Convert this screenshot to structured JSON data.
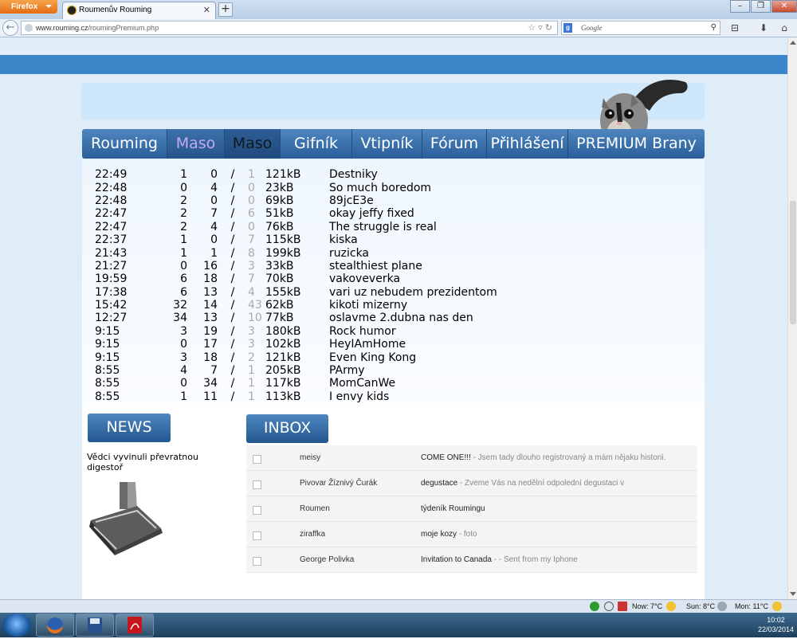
{
  "browser": {
    "menu_button": "Firefox",
    "tab_title": "Roumenův Rouming",
    "url_domain": "www.rouming.cz",
    "url_path": "/roumingPremium.php",
    "search_engine": "Google",
    "search_placeholder": "Google"
  },
  "menu": [
    "Rouming",
    "Maso",
    "Maso",
    "Gifník",
    "Vtipník",
    "Fórum",
    "Přihlášení",
    "PREMIUM Brany"
  ],
  "rows": [
    {
      "time": "22:49",
      "a": "1",
      "b": "0",
      "c": "1",
      "size": "121kB",
      "title": "Destniky"
    },
    {
      "time": "22:48",
      "a": "0",
      "b": "4",
      "c": "0",
      "size": "23kB",
      "title": "So much boredom"
    },
    {
      "time": "22:48",
      "a": "2",
      "b": "0",
      "c": "0",
      "size": "69kB",
      "title": "89jcE3e"
    },
    {
      "time": "22:47",
      "a": "2",
      "b": "7",
      "c": "6",
      "size": "51kB",
      "title": "okay jeffy fixed"
    },
    {
      "time": "22:47",
      "a": "2",
      "b": "4",
      "c": "0",
      "size": "76kB",
      "title": "The struggle is real"
    },
    {
      "time": "22:37",
      "a": "1",
      "b": "0",
      "c": "7",
      "size": "115kB",
      "title": "kiska"
    },
    {
      "time": "21:43",
      "a": "1",
      "b": "1",
      "c": "8",
      "size": "199kB",
      "title": "ruzicka"
    },
    {
      "time": "21:27",
      "a": "0",
      "b": "16",
      "c": "3",
      "size": "33kB",
      "title": "stealthiest plane"
    },
    {
      "time": "19:59",
      "a": "6",
      "b": "18",
      "c": "7",
      "size": "70kB",
      "title": "vakoveverka"
    },
    {
      "time": "17:38",
      "a": "6",
      "b": "13",
      "c": "4",
      "size": "155kB",
      "title": "vari uz nebudem prezidentom"
    },
    {
      "time": "15:42",
      "a": "32",
      "b": "14",
      "c": "43",
      "size": "62kB",
      "title": "kikoti mizerny"
    },
    {
      "time": "12:27",
      "a": "34",
      "b": "13",
      "c": "10",
      "size": "77kB",
      "title": "oslavme 2.dubna nas den"
    },
    {
      "time": "9:15",
      "a": "3",
      "b": "19",
      "c": "3",
      "size": "180kB",
      "title": "Rock humor"
    },
    {
      "time": "9:15",
      "a": "0",
      "b": "17",
      "c": "3",
      "size": "102kB",
      "title": "HeyIAmHome"
    },
    {
      "time": "9:15",
      "a": "3",
      "b": "18",
      "c": "2",
      "size": "121kB",
      "title": "Even King Kong"
    },
    {
      "time": "8:55",
      "a": "4",
      "b": "7",
      "c": "1",
      "size": "205kB",
      "title": "PArmy"
    },
    {
      "time": "8:55",
      "a": "0",
      "b": "34",
      "c": "1",
      "size": "117kB",
      "title": "MomCanWe"
    },
    {
      "time": "8:55",
      "a": "1",
      "b": "11",
      "c": "1",
      "size": "113kB",
      "title": "I envy kids"
    }
  ],
  "separator": "/",
  "news": {
    "button": "NEWS",
    "headline": "Vědci vyvinuli převratnou digestoř"
  },
  "inbox": {
    "button": "INBOX",
    "messages": [
      {
        "from": "meisy",
        "subject": "COME ONE!!!",
        "preview": " - Jsem tady dlouho registrovaný a mám nějaku historii."
      },
      {
        "from": "Pivovar Žíznivý Čurák",
        "subject": "degustace",
        "preview": " - Zveme Vás na nedělní odpolední degustaci v"
      },
      {
        "from": "Roumen",
        "subject": "týdeník Roumingu",
        "preview": ""
      },
      {
        "from": "ziraffka",
        "subject": "moje kozy",
        "preview": " - foto"
      },
      {
        "from": "George Polivka",
        "subject": "Invitation to Canada",
        "preview": " - - Sent from my Iphone"
      }
    ]
  },
  "statusbar": {
    "now": "Now: 7°C",
    "sun": "Sun: 8°C",
    "mon": "Mon: 11°C"
  },
  "taskbar": {
    "time": "10:02",
    "date": "22/03/2014"
  },
  "colors": {
    "accent": "#3b86c8",
    "menu_active": "#c3a8f2",
    "page_bg": "#dfedf9"
  }
}
